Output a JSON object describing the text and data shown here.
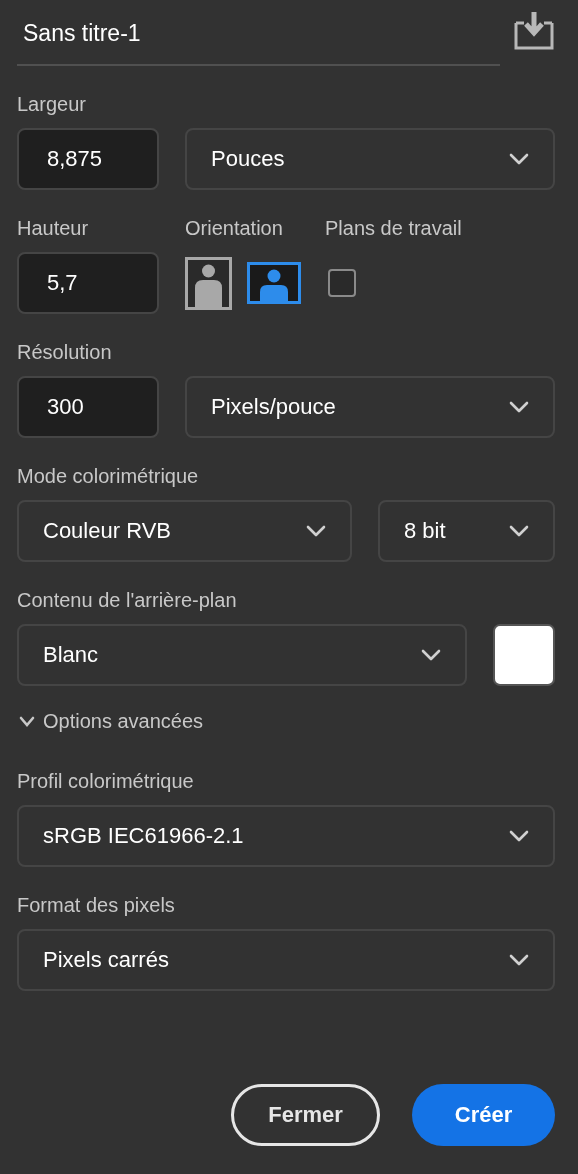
{
  "document": {
    "title": "Sans titre-1"
  },
  "width": {
    "label": "Largeur",
    "value": "8,875",
    "unit": "Pouces"
  },
  "height": {
    "label": "Hauteur",
    "value": "5,7"
  },
  "orientation": {
    "label": "Orientation",
    "options": [
      {
        "kind": "portrait",
        "selected": false
      },
      {
        "kind": "landscape",
        "selected": true
      }
    ]
  },
  "artboards": {
    "label": "Plans de travail",
    "checked": false
  },
  "resolution": {
    "label": "Résolution",
    "value": "300",
    "unit": "Pixels/pouce"
  },
  "color_mode": {
    "label": "Mode colorimétrique",
    "mode": "Couleur RVB",
    "depth": "8 bit"
  },
  "background": {
    "label": "Contenu de l'arrière-plan",
    "value": "Blanc",
    "color": "#ffffff"
  },
  "advanced": {
    "label": "Options avancées",
    "expanded": true
  },
  "color_profile": {
    "label": "Profil colorimétrique",
    "value": "sRGB IEC61966-2.1"
  },
  "pixel_format": {
    "label": "Format des pixels",
    "value": "Pixels carrés"
  },
  "buttons": [
    {
      "label": "Fermer",
      "kind": "secondary"
    },
    {
      "label": "Créer",
      "kind": "primary"
    }
  ]
}
